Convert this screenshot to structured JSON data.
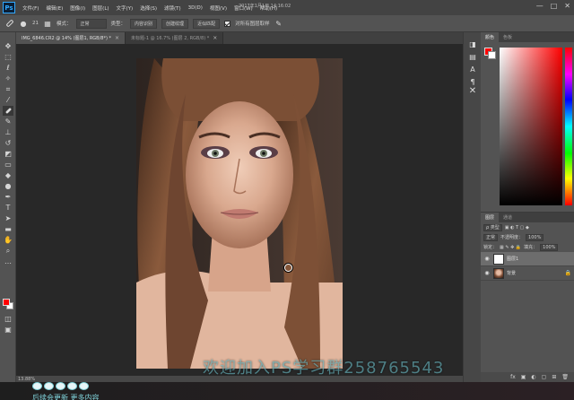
{
  "app": {
    "logo": "Ps",
    "title_center": "2017年1月1日 14:16:02"
  },
  "menu": [
    "文件(F)",
    "编辑(E)",
    "图像(I)",
    "图层(L)",
    "文字(Y)",
    "选择(S)",
    "滤镜(T)",
    "3D(D)",
    "视图(V)",
    "窗口(W)",
    "帮助(H)"
  ],
  "window_controls": [
    "—",
    "□",
    "✕"
  ],
  "options": {
    "brush_size": "21",
    "mode_label": "模式：",
    "mode_value": "正常",
    "type_label": "类型：",
    "content_aware": "内容识别",
    "create_texture": "创建纹理",
    "proximity_match": "近似匹配",
    "sample_all_label": "对所有图层取样"
  },
  "tabs": [
    {
      "label": "IMG_6846.CR2 @ 14% (图层1, RGB/8*) *",
      "close": "×",
      "active": true
    },
    {
      "label": "未标题-1 @ 16.7% (图层 2, RGB/8) *",
      "close": "×",
      "active": false
    }
  ],
  "status": {
    "zoom": "13.88%"
  },
  "watermark": "欢迎加入PS学习群258765543",
  "right_panels": {
    "color_tabs": [
      "颜色",
      "色板"
    ],
    "layer_tabs": [
      "图层",
      "通道"
    ],
    "kind_label": "ρ 类型",
    "blend_mode": "正常",
    "opacity_label": "不透明度：",
    "opacity_value": "100%",
    "lock_label": "锁定：",
    "fill_label": "填充：",
    "fill_value": "100%",
    "layers": [
      {
        "name": "图层1",
        "thumb": "white",
        "selected": true
      },
      {
        "name": "背景",
        "thumb": "face",
        "selected": false,
        "locked": true
      }
    ],
    "footer_icons": [
      "fx",
      "▣",
      "◐",
      "▢",
      "⊞",
      "🗑"
    ]
  },
  "bottom_overlay": {
    "text": "后续会更新 更多内容"
  },
  "colors": {
    "foreground": "#ff0000",
    "background": "#ffffff",
    "accent": "#31a8ff",
    "watermark": "#7fd2da"
  }
}
